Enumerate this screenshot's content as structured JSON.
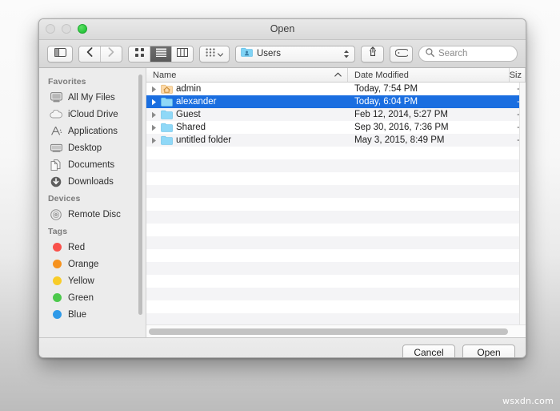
{
  "window": {
    "title": "Open",
    "traffic_lights": [
      {
        "name": "close",
        "color": "#dcdcdc"
      },
      {
        "name": "minimize",
        "color": "#dcdcdc"
      },
      {
        "name": "zoom",
        "color": "#27c63c"
      }
    ]
  },
  "toolbar": {
    "sidebar_toggle_icon": "sidebar-toggle-icon",
    "back_icon": "chevron-left-icon",
    "forward_icon": "chevron-right-icon",
    "view_icon_grid": "icon-view-icon",
    "view_list": "list-view-icon",
    "view_column": "column-view-icon",
    "arrange_icon": "arrange-grid-icon",
    "arrange_chevron": "chevron-down-icon",
    "path_label": "Users",
    "path_icon": "users-folder-icon",
    "stepper_icon": "up-down-stepper-icon",
    "share_icon": "share-icon",
    "tag_icon": "tag-icon",
    "search_icon": "search-icon",
    "search_placeholder": "Search",
    "search_value": ""
  },
  "sidebar": {
    "sections": [
      {
        "title": "Favorites",
        "items": [
          {
            "label": "All My Files",
            "icon": "all-my-files-icon"
          },
          {
            "label": "iCloud Drive",
            "icon": "icloud-icon"
          },
          {
            "label": "Applications",
            "icon": "applications-icon"
          },
          {
            "label": "Desktop",
            "icon": "desktop-icon"
          },
          {
            "label": "Documents",
            "icon": "documents-icon"
          },
          {
            "label": "Downloads",
            "icon": "downloads-icon"
          }
        ]
      },
      {
        "title": "Devices",
        "items": [
          {
            "label": "Remote Disc",
            "icon": "remote-disc-icon"
          }
        ]
      },
      {
        "title": "Tags",
        "items": [
          {
            "label": "Red",
            "icon": "tag-dot-icon",
            "color": "#f9504a"
          },
          {
            "label": "Orange",
            "icon": "tag-dot-icon",
            "color": "#f6921e"
          },
          {
            "label": "Yellow",
            "icon": "tag-dot-icon",
            "color": "#f8cc28"
          },
          {
            "label": "Green",
            "icon": "tag-dot-icon",
            "color": "#4cc94c"
          },
          {
            "label": "Blue",
            "icon": "tag-dot-icon",
            "color": "#2f9ae8"
          }
        ]
      }
    ]
  },
  "filelist": {
    "columns": [
      {
        "label": "Name",
        "sort": "ascending",
        "sort_icon": "chevron-up-icon"
      },
      {
        "label": "Date Modified",
        "sort": null
      },
      {
        "label": "Size",
        "truncated_label": "Siz",
        "sort": null
      }
    ],
    "rows": [
      {
        "name": "admin",
        "icon": "home-folder-icon",
        "date": "Today, 7:54 PM",
        "size": "-",
        "selected": false,
        "expander": "disclosure-triangle-icon"
      },
      {
        "name": "alexander",
        "icon": "folder-icon",
        "date": "Today, 6:04 PM",
        "size": "-",
        "selected": true,
        "expander": "disclosure-triangle-icon"
      },
      {
        "name": "Guest",
        "icon": "folder-icon",
        "date": "Feb 12, 2014, 5:27 PM",
        "size": "-",
        "selected": false,
        "expander": "disclosure-triangle-icon"
      },
      {
        "name": "Shared",
        "icon": "folder-icon",
        "date": "Sep 30, 2016, 7:36 PM",
        "size": "-",
        "selected": false,
        "expander": "disclosure-triangle-icon"
      },
      {
        "name": "untitled folder",
        "icon": "folder-icon",
        "date": "May 3, 2015, 8:49 PM",
        "size": "-",
        "selected": false,
        "expander": "disclosure-triangle-icon"
      }
    ],
    "selection_color": "#1a6ee0",
    "empty_row_count": 14
  },
  "footer": {
    "cancel_label": "Cancel",
    "open_label": "Open"
  },
  "watermark": "wsxdn.com"
}
